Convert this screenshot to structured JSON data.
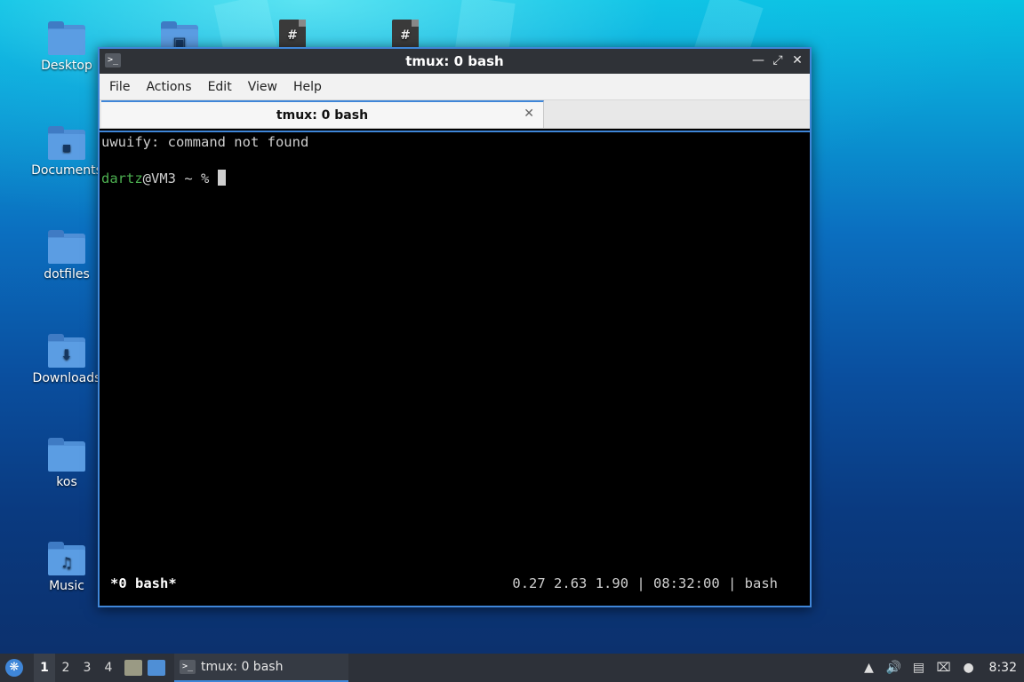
{
  "desktop": {
    "icons": [
      {
        "label": "Desktop",
        "glyph": ""
      },
      {
        "label": "",
        "glyph": "▣"
      },
      {
        "label": "",
        "glyph": "#"
      },
      {
        "label": "",
        "glyph": "#"
      },
      {
        "label": "Documents",
        "glyph": "▪"
      },
      {
        "label": "dotfiles",
        "glyph": ""
      },
      {
        "label": "Downloads",
        "glyph": "⬇"
      },
      {
        "label": "kos",
        "glyph": ""
      },
      {
        "label": "Music",
        "glyph": "♫"
      }
    ]
  },
  "window": {
    "title": "tmux: 0 bash",
    "icon_glyph": ">_",
    "controls": {
      "minimize": "—",
      "maximize": "⤢",
      "close": "✕"
    },
    "menu": [
      "File",
      "Actions",
      "Edit",
      "View",
      "Help"
    ],
    "tab": {
      "label": "tmux: 0 bash",
      "close": "✕"
    }
  },
  "terminal": {
    "line1": "uwuify: command not found",
    "prompt_user": "dartz",
    "prompt_rest": "@VM3 ~ % ",
    "status_left": "*0 bash*",
    "status_right": "0.27 2.63 1.90 | 08:32:00 | bash"
  },
  "taskbar": {
    "start_glyph": "❋",
    "workspaces": [
      "1",
      "2",
      "3",
      "4"
    ],
    "task": {
      "icon": ">_",
      "label": "tmux: 0 bash"
    },
    "tray": {
      "up": "▲",
      "volume": "🔊",
      "clipboard": "▤",
      "network": "⌧",
      "notify": "●"
    },
    "clock": "8:32"
  },
  "colors": {
    "accent": "#3f86d8",
    "prompt_user": "#4caf50",
    "taskbar_bg": "#2d3139"
  }
}
